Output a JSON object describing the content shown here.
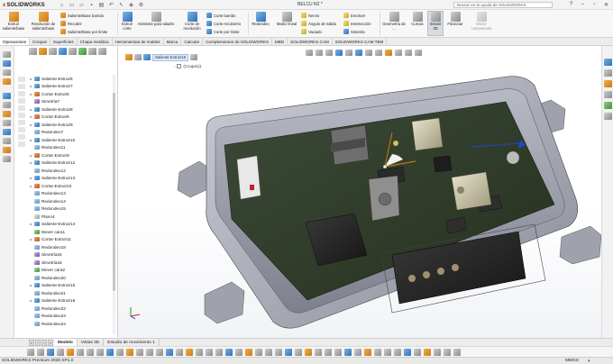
{
  "app": {
    "logo_text": "SOLIDWORKS",
    "document_title": "BELCU N2 *",
    "search_placeholder": "Buscar en la ayuda de SOLIDWORKS",
    "help_label": "?",
    "window_minimize": "–",
    "window_restore": "▫",
    "window_close": "✕"
  },
  "ribbon": {
    "extrude_boss": "Extruir saliente/base",
    "revolve_boss": "Revolución de saliente/base",
    "swept_boss": "Saliente/Base barrido",
    "lofted_boss": "Recubrir",
    "boundary_boss": "Saliente/Base por límite",
    "extruded_cut": "Extruir corte",
    "hole_wizard": "Asistente para taladro",
    "revolved_cut": "Corte de revolución",
    "swept_cut": "Corte barrido",
    "lofted_cut": "Corte recubierto",
    "boundary_cut": "Corte por límite",
    "fillet": "Redondeo",
    "linear_pattern": "Matriz lineal",
    "rib": "Nervio",
    "draft": "Ángulo de salida",
    "shell": "Vaciado",
    "wrap": "Envolver",
    "intersect": "Intersección",
    "mirror": "Simetría",
    "reference_geometry": "Geometría de ...",
    "curves": "Curvas",
    "instant3d": "Instant 3D",
    "flex": "Flexionar",
    "move_component": "Mover componente"
  },
  "tabs": [
    "Operaciones",
    "Croquis",
    "Superficies",
    "Chapa metálica",
    "Herramientas de moldes",
    "Marca",
    "Calcular",
    "Complementos de SOLIDWORKS",
    "MBD",
    "SOLIDWORKS CAM",
    "SOLIDWORKS CAM TBM"
  ],
  "tree": {
    "items": [
      "Saliente-Extruir5",
      "Saliente-Extruir7",
      "Cortar-Extruir5",
      "Simetría7",
      "Saliente-Extruir8",
      "Cortar-Extruir6",
      "Saliente-Extruir9",
      "Redondeo7",
      "Saliente-Extruir10",
      "Redondeo11",
      "Cortar-Extruir9",
      "Saliente-Extruir12",
      "Redondeo12",
      "Saliente-Extruir13",
      "Cortar-Extruir10",
      "Redondeo13",
      "Redondeo14",
      "Redondeo15",
      "Plano4",
      "Saliente-Extruir14",
      "Mover cara1",
      "Cortar-Extruir11",
      "Redondeo18",
      "Simetría15",
      "Simetría16",
      "Mover cara2",
      "Redondeo20",
      "Saliente-Extruir15",
      "Redondeo21",
      "Saliente-Extruir16",
      "Redondeo22",
      "Redondeo23",
      "Redondeo24"
    ]
  },
  "viewport": {
    "breadcrumb_label": "Saliente-Extruir16",
    "sketch_label": "(Croquis)1"
  },
  "bottom_tabs": [
    "Modelo",
    "Vistas 3D",
    "Estudio de movimiento 1"
  ],
  "status": {
    "left": "SOLIDWORKS Premium 2020 SP1.0",
    "units": "MMGS",
    "gear": "▾"
  }
}
